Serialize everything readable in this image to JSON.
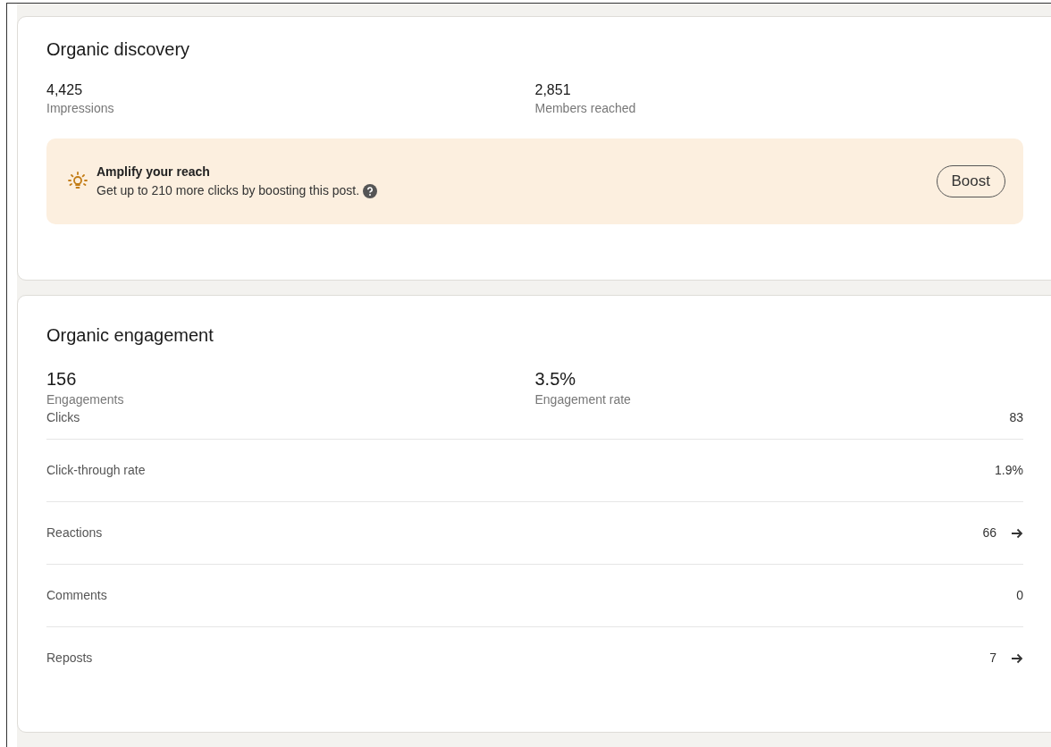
{
  "discovery": {
    "title": "Organic discovery",
    "stats": [
      {
        "value": "4,425",
        "label": "Impressions"
      },
      {
        "value": "2,851",
        "label": "Members reached"
      }
    ],
    "promo": {
      "title": "Amplify your reach",
      "text": "Get up to 210 more clicks by boosting this post.",
      "button": "Boost"
    }
  },
  "engagement": {
    "title": "Organic engagement",
    "stats": [
      {
        "value": "156",
        "label": "Engagements"
      },
      {
        "value": "3.5%",
        "label": "Engagement rate"
      }
    ],
    "rows": [
      {
        "label": "Clicks",
        "value": "83",
        "has_link": false
      },
      {
        "label": "Click-through rate",
        "value": "1.9%",
        "has_link": false
      },
      {
        "label": "Reactions",
        "value": "66",
        "has_link": true
      },
      {
        "label": "Comments",
        "value": "0",
        "has_link": false
      },
      {
        "label": "Reposts",
        "value": "7",
        "has_link": true
      }
    ]
  }
}
